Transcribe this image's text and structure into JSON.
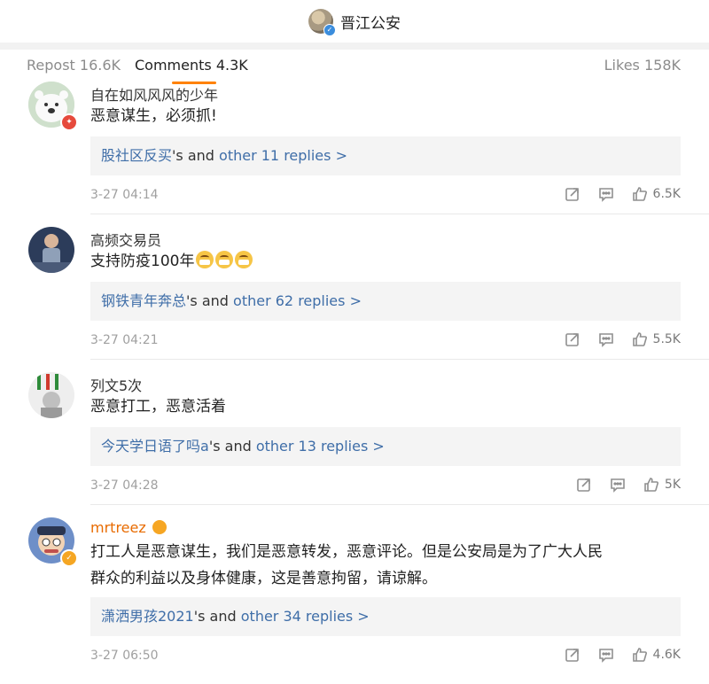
{
  "header": {
    "title": "晋江公安"
  },
  "tabs": {
    "repost": "Repost 16.6K",
    "comments": "Comments 4.3K",
    "likes": "Likes 158K"
  },
  "comments": [
    {
      "username": "自在如风风风的少年",
      "text": "恶意谋生，必须抓!",
      "reply_user": "股社区反买",
      "reply_suffix": "'s and",
      "reply_more": "other 11 replies >",
      "time": "3-27 04:14",
      "likes": "6.5K"
    },
    {
      "username": "高频交易员",
      "text": "支持防疫100年",
      "reply_user": "钢铁青年奔总",
      "reply_suffix": "'s and",
      "reply_more": "other 62 replies >",
      "time": "3-27 04:21",
      "likes": "5.5K"
    },
    {
      "username": "列文5次",
      "text": "恶意打工，恶意活着",
      "reply_user": "今天学日语了吗a",
      "reply_suffix": "'s and",
      "reply_more": "other 13 replies >",
      "time": "3-27 04:28",
      "likes": "5K"
    },
    {
      "username": "mrtreez",
      "text_line1": "打工人是恶意谋生，我们是恶意转发，恶意评论。但是公安局是为了广大人民",
      "text_line2": "群众的利益以及身体健康，这是善意拘留，请谅解。",
      "reply_user": "潇洒男孩2021",
      "reply_suffix": "'s and",
      "reply_more": "other 34 replies >",
      "time": "3-27 06:50",
      "likes": "4.6K"
    }
  ],
  "icons": {
    "share": "share-icon",
    "comment": "comment-icon",
    "like": "thumbs-up-icon"
  },
  "colors": {
    "accent": "#ff8200",
    "link": "#3f6ea8",
    "vip": "#e86b00"
  }
}
